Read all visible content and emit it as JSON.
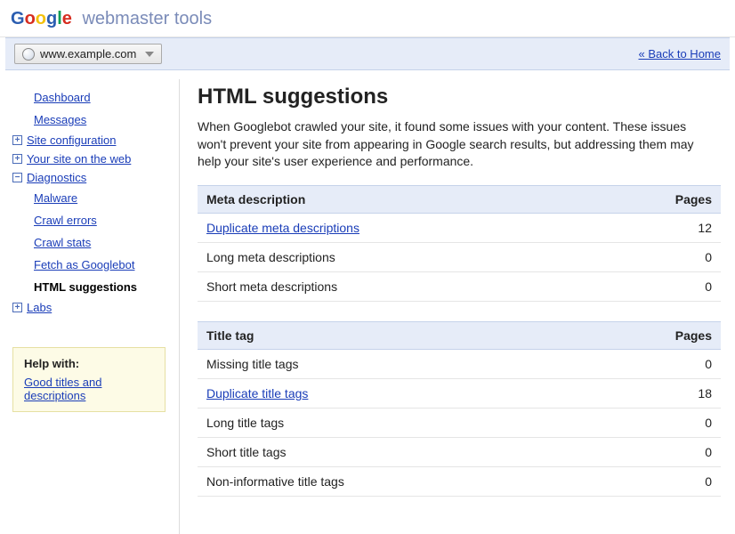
{
  "header": {
    "subtitle": "webmaster tools"
  },
  "toolbar": {
    "site": "www.example.com",
    "back_link": "« Back to Home"
  },
  "sidebar": {
    "dashboard": "Dashboard",
    "messages": "Messages",
    "site_configuration": "Site configuration",
    "your_site_on_web": "Your site on the web",
    "diagnostics": "Diagnostics",
    "diag": {
      "malware": "Malware",
      "crawl_errors": "Crawl errors",
      "crawl_stats": "Crawl stats",
      "fetch_as_googlebot": "Fetch as Googlebot",
      "html_suggestions": "HTML suggestions"
    },
    "labs": "Labs"
  },
  "help": {
    "title": "Help with:",
    "link": "Good titles and descriptions"
  },
  "page": {
    "title": "HTML suggestions",
    "intro": "When Googlebot crawled your site, it found some issues with your content. These issues won't prevent your site from appearing in Google search results, but addressing them may help your site's user experience and performance."
  },
  "meta_section": {
    "header_label": "Meta description",
    "header_pages": "Pages",
    "rows": [
      {
        "label": "Duplicate meta descriptions",
        "count": "12",
        "link": true
      },
      {
        "label": "Long meta descriptions",
        "count": "0",
        "link": false
      },
      {
        "label": "Short meta descriptions",
        "count": "0",
        "link": false
      }
    ]
  },
  "title_section": {
    "header_label": "Title tag",
    "header_pages": "Pages",
    "rows": [
      {
        "label": "Missing title tags",
        "count": "0",
        "link": false
      },
      {
        "label": "Duplicate title tags",
        "count": "18",
        "link": true
      },
      {
        "label": "Long title tags",
        "count": "0",
        "link": false
      },
      {
        "label": "Short title tags",
        "count": "0",
        "link": false
      },
      {
        "label": "Non-informative title tags",
        "count": "0",
        "link": false
      }
    ]
  }
}
